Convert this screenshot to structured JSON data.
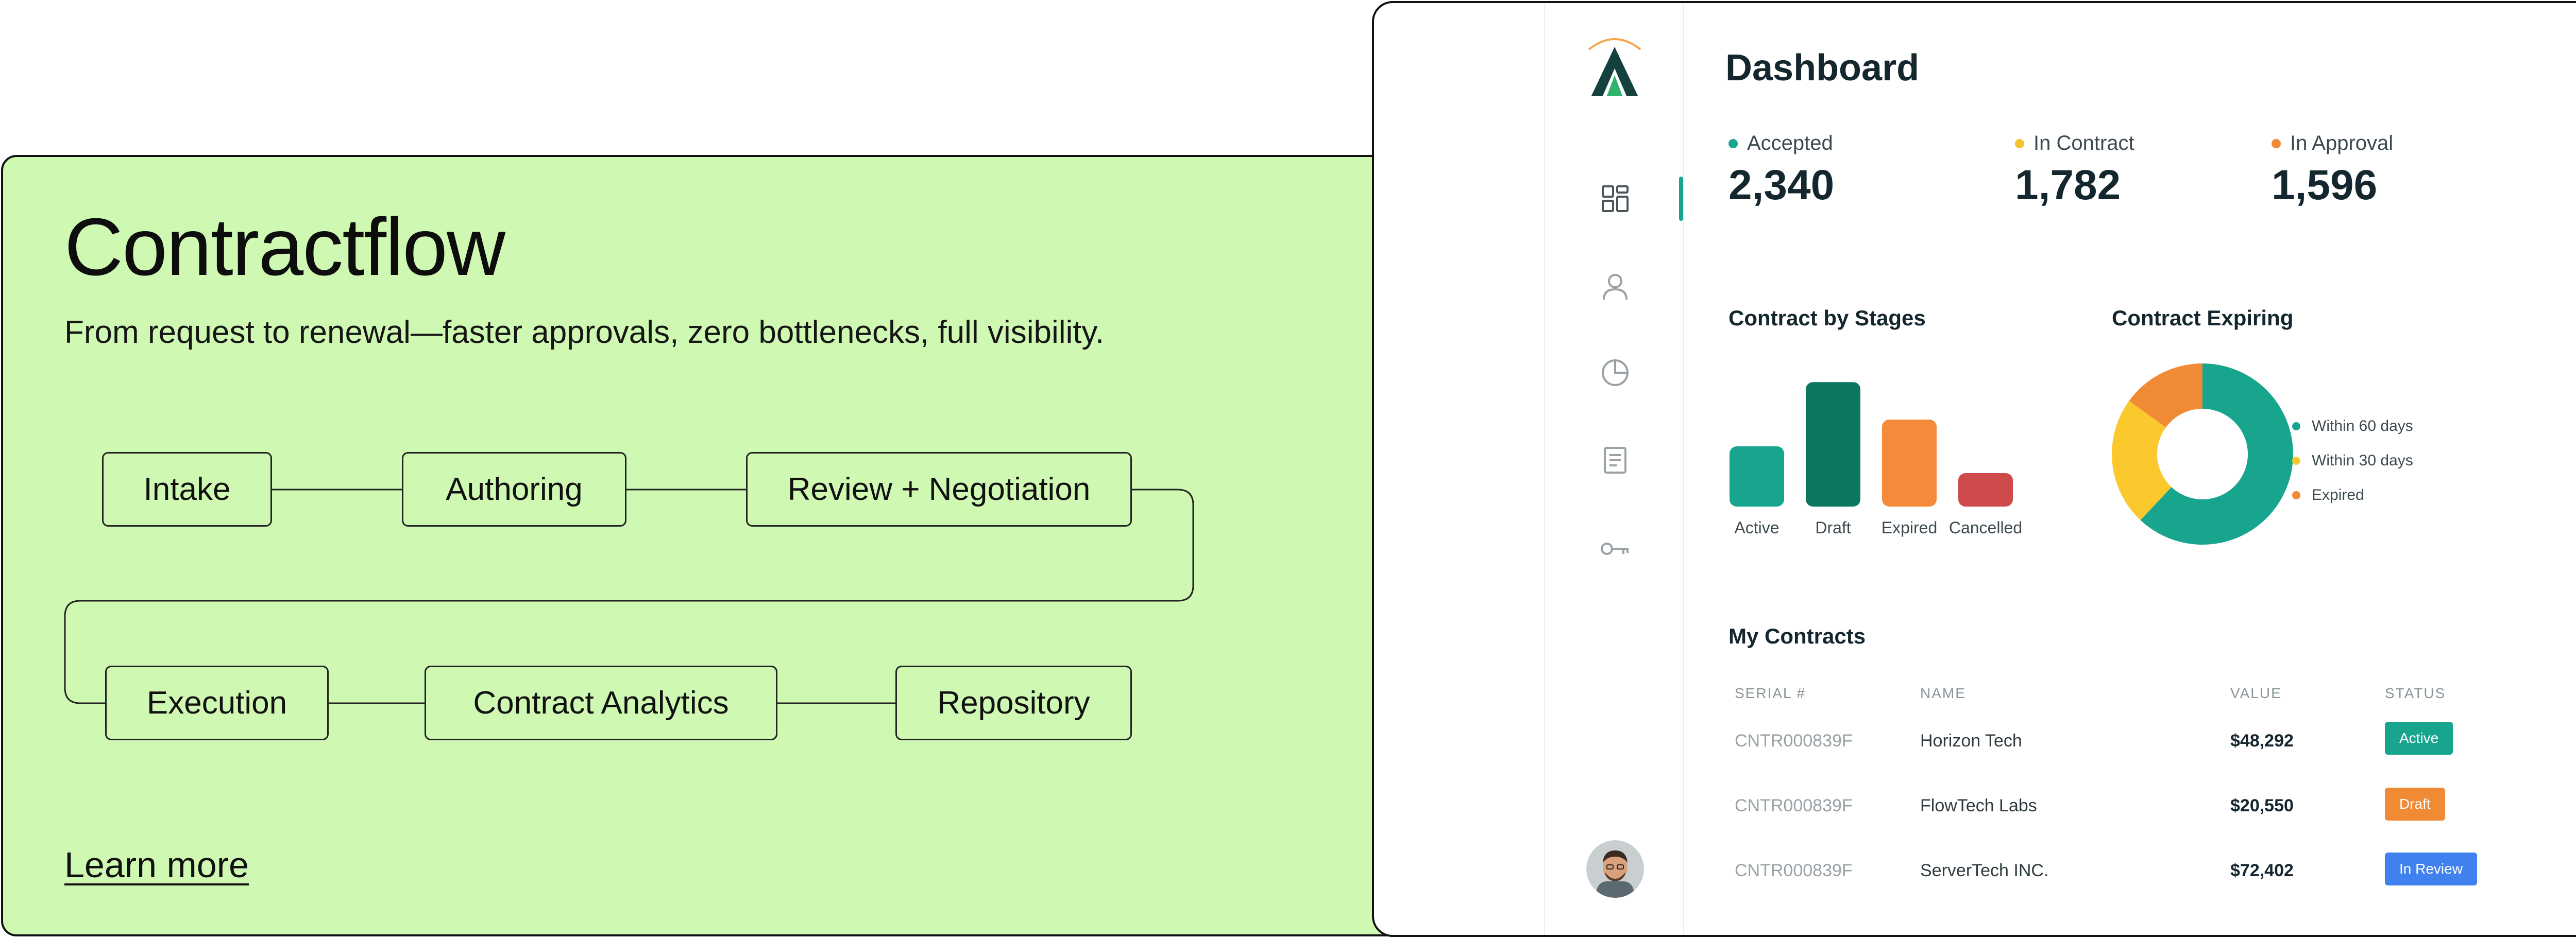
{
  "promo": {
    "title": "Contractflow",
    "subtitle": "From request to renewal—faster approvals, zero bottlenecks, full visibility.",
    "steps": [
      "Intake",
      "Authoring",
      "Review + Negotiation",
      "Execution",
      "Contract Analytics",
      "Repository"
    ],
    "learn_more": "Learn more"
  },
  "dashboard": {
    "title": "Dashboard",
    "sidebar": {
      "icons": [
        "grid-icon",
        "user-icon",
        "pie-chart-icon",
        "document-icon",
        "key-icon"
      ],
      "active_index": 0
    },
    "stats": [
      {
        "label": "Accepted",
        "value": "2,340",
        "color": "#17a58e"
      },
      {
        "label": "In Contract",
        "value": "1,782",
        "color": "#f4c42e"
      },
      {
        "label": "In Approval",
        "value": "1,596",
        "color": "#f08a35"
      }
    ],
    "stages_title": "Contract by Stages",
    "expiring_title": "Contract Expiring",
    "contracts_title": "My Contracts",
    "table": {
      "headers": [
        "SERIAL #",
        "NAME",
        "VALUE",
        "STATUS"
      ],
      "rows": [
        {
          "serial": "CNTR000839F",
          "name": "Horizon Tech",
          "value": "$48,292",
          "status": "Active",
          "status_color": "#17a58e"
        },
        {
          "serial": "CNTR000839F",
          "name": "FlowTech Labs",
          "value": "$20,550",
          "status": "Draft",
          "status_color": "#f08a35"
        },
        {
          "serial": "CNTR000839F",
          "name": "ServerTech INC.",
          "value": "$72,402",
          "status": "In Review",
          "status_color": "#3f82ef"
        }
      ]
    }
  },
  "chart_data": [
    {
      "type": "bar",
      "title": "Contract by Stages",
      "categories": [
        "Active",
        "Draft",
        "Expired",
        "Cancelled"
      ],
      "values": [
        45,
        93,
        65,
        25
      ],
      "colors": [
        "#17a58e",
        "#0c7660",
        "#f48a3a",
        "#cf4b4b"
      ],
      "ylim": [
        0,
        100
      ],
      "grid": false
    },
    {
      "type": "pie",
      "title": "Contract Expiring",
      "labels": [
        "Within 60 days",
        "Within 30 days",
        "Expired"
      ],
      "values": [
        62,
        23,
        15
      ],
      "colors": [
        "#17a58e",
        "#fbc92e",
        "#f08a35"
      ],
      "donut": true,
      "legend": "right"
    }
  ]
}
